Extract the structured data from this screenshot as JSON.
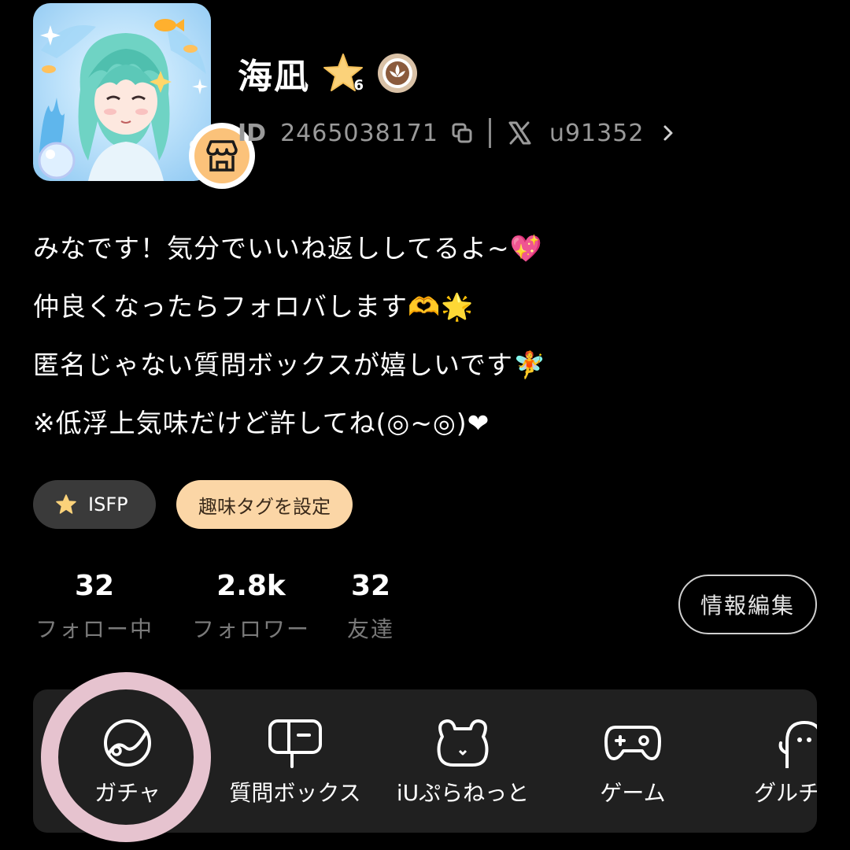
{
  "profile": {
    "name": "海凪",
    "level": "6",
    "id_label": "ID",
    "id_value": "2465038171",
    "x_handle": "u91352"
  },
  "bio": [
    "みなです！気分でいいね返ししてるよ~💖",
    "仲良くなったらフォロバします🫶🌟",
    "匿名じゃない質問ボックスが嬉しいです🧚",
    "※低浮上気味だけど許してね(◎~◎)❤"
  ],
  "tags": {
    "mbti": "ISFP",
    "hobby": "趣味タグを設定"
  },
  "stats": [
    {
      "value": "32",
      "label": "フォロー中"
    },
    {
      "value": "2.8k",
      "label": "フォロワー"
    },
    {
      "value": "32",
      "label": "友達"
    }
  ],
  "edit_button": "情報編集",
  "menu": [
    {
      "label": "ガチャ",
      "icon": "gacha-icon"
    },
    {
      "label": "質問ボックス",
      "icon": "mailbox-icon"
    },
    {
      "label": "iUぷらねっと",
      "icon": "bear-icon"
    },
    {
      "label": "ゲーム",
      "icon": "gamepad-icon"
    },
    {
      "label": "グルチ",
      "icon": "group-chat-icon"
    }
  ],
  "colors": {
    "background": "#000000",
    "muted_text": "#9a9a9a",
    "tag_dark": "#3a3a3a",
    "tag_peach": "#fbd6a6",
    "menu_panel": "#202020",
    "highlight_ring": "#e6c3cf"
  }
}
